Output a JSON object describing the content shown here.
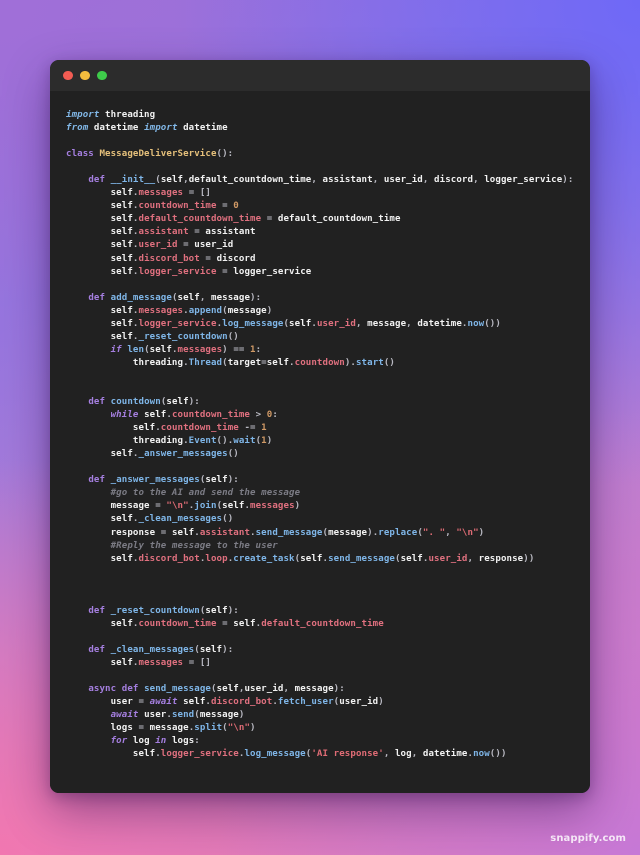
{
  "background": {
    "gradient_from": "#a06fd8",
    "gradient_mid": "#6e68f7",
    "gradient_to": "#ef78b0",
    "accent_pink": "#e87bb2"
  },
  "window": {
    "background": "#212121",
    "titlebar_background": "#2c2c2c",
    "controls": [
      {
        "name": "close",
        "color": "#f25c53"
      },
      {
        "name": "minimize",
        "color": "#f3bc3e"
      },
      {
        "name": "maximize",
        "color": "#3ecb4a"
      }
    ]
  },
  "watermark": {
    "text": "snappify.com"
  },
  "editor": {
    "language": "python",
    "theme": "one-dark",
    "code": "import threading\nfrom datetime import datetime\n\nclass MessageDeliverService():\n\n    def __init__(self,default_countdown_time, assistant, user_id, discord, logger_service):\n        self.messages = []\n        self.countdown_time = 0\n        self.default_countdown_time = default_countdown_time\n        self.assistant = assistant\n        self.user_id = user_id\n        self.discord_bot = discord\n        self.logger_service = logger_service\n\n    def add_message(self, message):\n        self.messages.append(message)\n        self.logger_service.log_message(self.user_id, message, datetime.now())\n        self._reset_countdown()\n        if len(self.messages) == 1:\n            threading.Thread(target=self.countdown).start()\n\n\n    def countdown(self):\n        while self.countdown_time > 0:\n            self.countdown_time -= 1\n            threading.Event().wait(1)\n        self._answer_messages()\n\n    def _answer_messages(self):\n        #go to the AI and send the message\n        message = \"\\n\".join(self.messages)\n        self._clean_messages()\n        response = self.assistant.send_message(message).replace(\". \", \"\\n\")\n        #Reply the message to the user\n        self.discord_bot.loop.create_task(self.send_message(self.user_id, response))\n\n\n\n    def _reset_countdown(self):\n        self.countdown_time = self.default_countdown_time\n\n    def _clean_messages(self):\n        self.messages = []\n\n    async def send_message(self,user_id, message):\n        user = await self.discord_bot.fetch_user(user_id)\n        await user.send(message)\n        logs = message.split(\"\\n\")\n        for log in logs:\n            self.logger_service.log_message('AI response', log, datetime.now())",
    "lines": [
      "import threading",
      "from datetime import datetime",
      "",
      "class MessageDeliverService():",
      "",
      "    def __init__(self,default_countdown_time, assistant, user_id, discord, logger_service):",
      "        self.messages = []",
      "        self.countdown_time = 0",
      "        self.default_countdown_time = default_countdown_time",
      "        self.assistant = assistant",
      "        self.user_id = user_id",
      "        self.discord_bot = discord",
      "        self.logger_service = logger_service",
      "",
      "    def add_message(self, message):",
      "        self.messages.append(message)",
      "        self.logger_service.log_message(self.user_id, message, datetime.now())",
      "        self._reset_countdown()",
      "        if len(self.messages) == 1:",
      "            threading.Thread(target=self.countdown).start()",
      "",
      "",
      "    def countdown(self):",
      "        while self.countdown_time > 0:",
      "            self.countdown_time -= 1",
      "            threading.Event().wait(1)",
      "        self._answer_messages()",
      "",
      "    def _answer_messages(self):",
      "        #go to the AI and send the message",
      "        message = \"\\n\".join(self.messages)",
      "        self._clean_messages()",
      "        response = self.assistant.send_message(message).replace(\". \", \"\\n\")",
      "        #Reply the message to the user",
      "        self.discord_bot.loop.create_task(self.send_message(self.user_id, response))",
      "",
      "",
      "",
      "    def _reset_countdown(self):",
      "        self.countdown_time = self.default_countdown_time",
      "",
      "    def _clean_messages(self):",
      "        self.messages = []",
      "",
      "    async def send_message(self,user_id, message):",
      "        user = await self.discord_bot.fetch_user(user_id)",
      "        await user.send(message)",
      "        logs = message.split(\"\\n\")",
      "        for log in logs:",
      "            self.logger_service.log_message('AI response', log, datetime.now())"
    ]
  }
}
